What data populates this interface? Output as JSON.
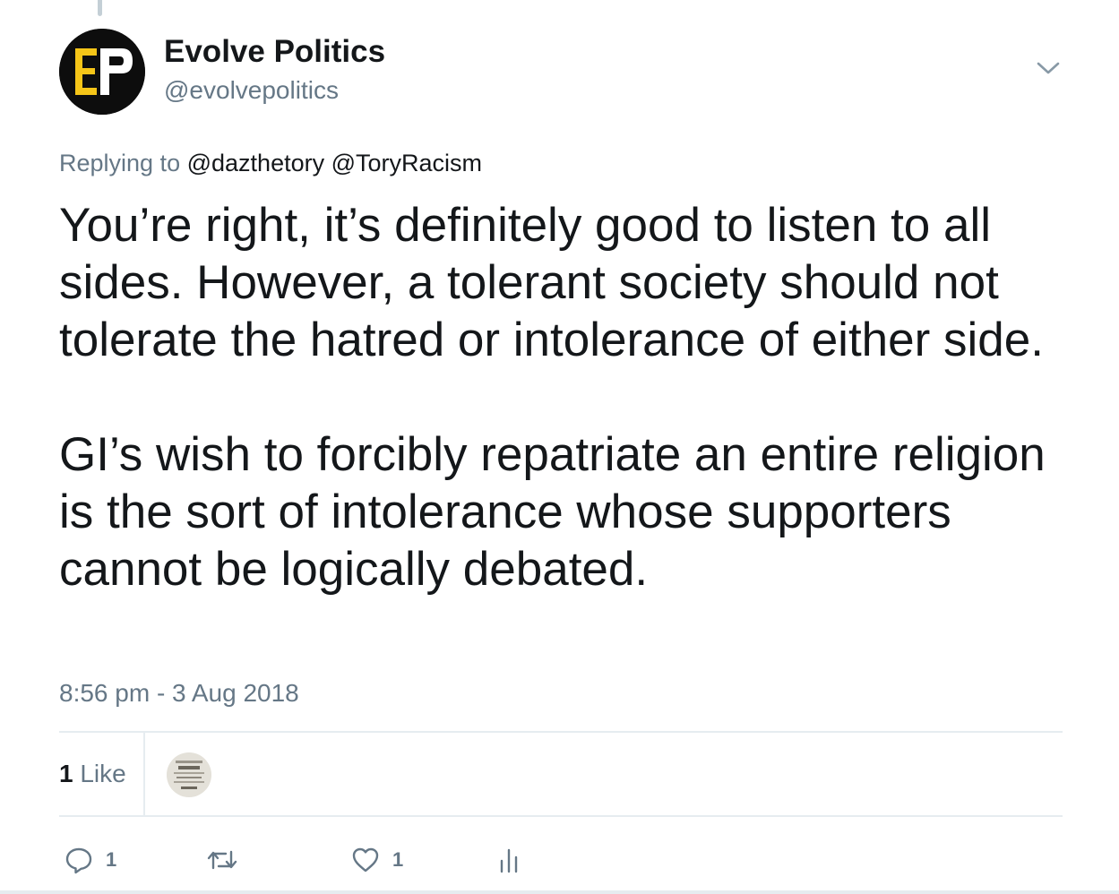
{
  "tweet": {
    "author": {
      "display_name": "Evolve Politics",
      "handle": "@evolvepolitics",
      "avatar_icon": "evolve-politics-logo",
      "avatar_initials": "EP"
    },
    "replying_to": {
      "prefix": "Replying to",
      "mentions": [
        "@dazthetory",
        "@ToryRacism"
      ]
    },
    "text_paragraphs": [
      "You’re right, it’s definitely good to listen to all sides. However, a tolerant society should not tolerate the hatred or intolerance of either side.",
      "GI’s wish to forcibly repatriate an entire religion is the sort of intolerance whose supporters cannot be logically debated."
    ],
    "timestamp": "8:56 pm - 3 Aug 2018",
    "stats": {
      "like_count": "1",
      "like_label": "Like"
    },
    "actions": {
      "reply_count": "1",
      "like_count": "1"
    }
  },
  "colors": {
    "text": "#14171a",
    "secondary": "#657786",
    "divider": "#e6ecf0",
    "logo_yellow": "#f5c518",
    "logo_bg": "#0d0d0d"
  }
}
